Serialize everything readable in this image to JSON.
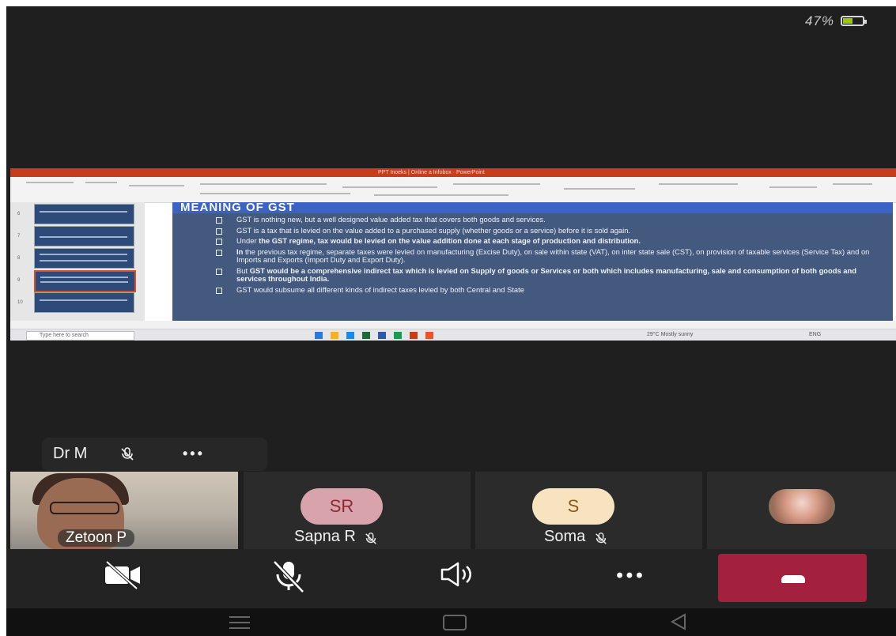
{
  "status_bar": {
    "battery_percent": "47%",
    "battery_level": 0.47
  },
  "presentation": {
    "window_title": "PPT Inoeks | Online a Infobox · PowerPoint",
    "slide_title": "MEANING OF GST",
    "bullets": [
      {
        "text": "GST is nothing new, but a well designed value added tax that covers both goods and services."
      },
      {
        "text": "GST is a tax that is levied on the value added to a purchased supply (whether goods or a service) before it is sold again."
      },
      {
        "pre": "Under ",
        "bold": "the GST regime, tax would be levied on the value addition done at each stage of production and distribution.",
        "post": ""
      },
      {
        "pre": "",
        "bold": "In",
        "post": " the previous tax regime, separate taxes were levied on manufacturing (Excise Duty), on sale within state (VAT), on inter state sale (CST), on provision of taxable services (Service Tax) and on Imports and Exports (Import Duty and Export Duty)."
      },
      {
        "pre": "But ",
        "bold": "GST would be a comprehensive indirect tax which is levied on Supply of goods or Services or both which includes manufacturing, sale and consumption of both goods and services throughout India.",
        "post": ""
      },
      {
        "text": "GST would subsume all different kinds of indirect taxes levied by both Central and State"
      }
    ],
    "slide_numbers": [
      "6",
      "7",
      "8",
      "9",
      "10"
    ],
    "taskbar_search": "Type here to search",
    "taskbar_weather": "29°C Mostly sunny",
    "taskbar_lang": "ENG"
  },
  "participants": {
    "pinned": {
      "name": "Dr M",
      "mic_icon": "mic-off-icon",
      "more_label": "•••"
    },
    "tiles": [
      {
        "name": "Zetoon P",
        "type": "video"
      },
      {
        "name": "Sapna R",
        "initials": "SR",
        "avatar_color": "#d8a3ab",
        "initials_color": "#8a2a35"
      },
      {
        "name": "Soma",
        "initials": "S",
        "avatar_color": "#f7e3bf",
        "initials_color": "#8a5a12"
      },
      {
        "name": "",
        "type": "photo"
      }
    ]
  },
  "controls": {
    "camera_icon": "camera-off-icon",
    "mic_icon": "mic-off-icon",
    "speaker_icon": "speaker-icon",
    "more_label": "•••",
    "hangup_color": "#a4203f"
  }
}
